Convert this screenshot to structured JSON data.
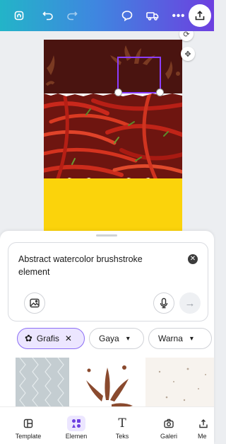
{
  "topbar": {
    "home_icon": "home-icon",
    "undo_icon": "undo-icon",
    "redo_icon": "redo-icon",
    "comment_icon": "comment-icon",
    "delivery_icon": "truck-icon",
    "more_icon": "more-icon",
    "upload_icon": "upload-icon"
  },
  "canvas": {
    "colors": {
      "dark_brown": "#4a1410",
      "yellow": "#fbd30b",
      "chili_red": "#b3231a",
      "selection": "#8b3dff"
    }
  },
  "prompt": {
    "text": "Abstract watercolor brushstroke element",
    "clear_icon": "close-icon",
    "image_icon": "image-icon",
    "mic_icon": "microphone-icon",
    "send_icon": "arrow-right-icon"
  },
  "filters": [
    {
      "label": "Grafis",
      "icon": "flower-icon",
      "active": true,
      "trailing": "✕"
    },
    {
      "label": "Gaya",
      "trailing": "⌄"
    },
    {
      "label": "Warna",
      "trailing": "⌄"
    }
  ],
  "nav": [
    {
      "label": "Template",
      "icon": "template-icon"
    },
    {
      "label": "Elemen",
      "icon": "elements-icon",
      "active": true
    },
    {
      "label": "Teks",
      "icon": "text-icon"
    },
    {
      "label": "Galeri",
      "icon": "camera-icon"
    },
    {
      "label": "Me",
      "icon": "upload-icon"
    }
  ],
  "accent": "#8b3dff"
}
